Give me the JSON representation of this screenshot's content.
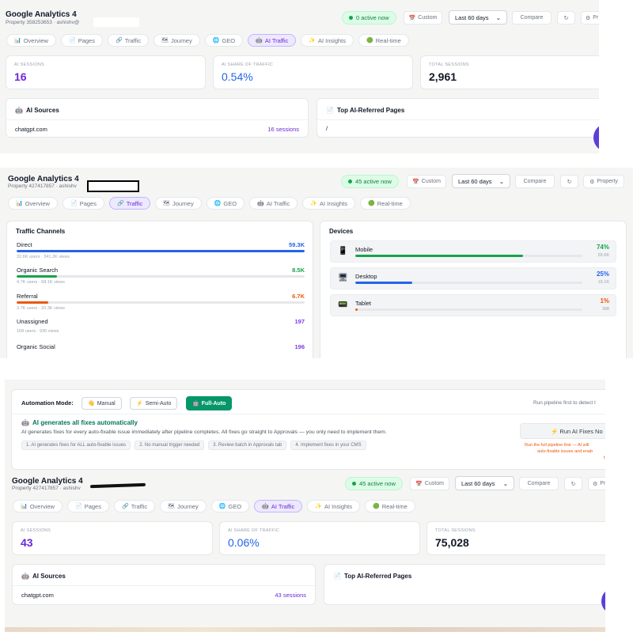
{
  "tabs": [
    {
      "icon": "📊",
      "label": "Overview"
    },
    {
      "icon": "📄",
      "label": "Pages"
    },
    {
      "icon": "🔗",
      "label": "Traffic"
    },
    {
      "icon": "🗺",
      "label": "Journey"
    },
    {
      "icon": "🌐",
      "label": "GEO"
    },
    {
      "icon": "🤖",
      "label": "AI Traffic"
    },
    {
      "icon": "✨",
      "label": "AI Insights"
    },
    {
      "icon": "🟢",
      "label": "Real-time"
    }
  ],
  "toolbar": {
    "custom": "Custom",
    "range": "Last 60 days",
    "compare": "Compare",
    "refresh": "↻",
    "property": "Property",
    "property_short": "Pr"
  },
  "panel1": {
    "title": "Google Analytics 4",
    "property": "Property 358253653 · ashishv@",
    "active": "0 active now",
    "kpis": [
      {
        "label": "AI SESSIONS",
        "value": "16"
      },
      {
        "label": "AI SHARE OF TRAFFIC",
        "value": "0.54%"
      },
      {
        "label": "TOTAL SESSIONS",
        "value": "2,961"
      }
    ],
    "ai_sources_title": "AI Sources",
    "sources": [
      {
        "name": "chatgpt.com",
        "sessions": "16 sessions"
      }
    ],
    "top_pages_title": "Top AI-Referred Pages",
    "pages": [
      "/"
    ]
  },
  "panel2": {
    "title": "Google Analytics 4",
    "property": "Property 427417857 · ashishv",
    "active": "45 active now",
    "channels_title": "Traffic Channels",
    "channels": [
      {
        "name": "Direct",
        "value": "59.3K",
        "sub": "32.6K users · 341.2K views",
        "share": 100,
        "color": "#2563eb"
      },
      {
        "name": "Organic Search",
        "value": "8.5K",
        "sub": "4.7K users · 68.1K views",
        "share": 14,
        "color": "#16a34a"
      },
      {
        "name": "Referral",
        "value": "6.7K",
        "sub": "3.7K users · 20.3K views",
        "share": 11,
        "color": "#ea580c"
      },
      {
        "name": "Unassigned",
        "value": "197",
        "sub": "168 users · 935 views",
        "share": 0,
        "color": "#7c3aed"
      },
      {
        "name": "Organic Social",
        "value": "196",
        "sub": "",
        "share": 0,
        "color": "#7c3aed"
      }
    ],
    "devices_title": "Devices",
    "devices": [
      {
        "icon": "📱",
        "name": "Mobile",
        "pct": "74%",
        "count": "55.6K",
        "share": 74,
        "color": "#16a34a"
      },
      {
        "icon": "🖥",
        "name": "Desktop",
        "pct": "25%",
        "count": "19.1K",
        "share": 25,
        "color": "#2563eb"
      },
      {
        "icon": "📟",
        "name": "Tablet",
        "pct": "1%",
        "count": "398",
        "share": 1,
        "color": "#ea580c"
      }
    ]
  },
  "panel3": {
    "automation_label": "Automation Mode:",
    "modes": [
      {
        "icon": "👋",
        "label": "Manual"
      },
      {
        "icon": "⚡",
        "label": "Semi-Auto"
      },
      {
        "icon": "🤖",
        "label": "Full-Auto"
      }
    ],
    "pipeline_hint": "Run pipeline first to detect I",
    "auto_title": "AI generates all fixes automatically",
    "auto_desc": "AI generates fixes for every auto-fixable issue immediately after pipeline completes. All fixes go straight to Approvals — you only need to implement them.",
    "steps": [
      "1. AI generates fixes for ALL auto-fixable issues",
      "2. No manual trigger needed",
      "3. Review batch in Approvals tab",
      "4. Implement fixes in your CMS"
    ],
    "run_button": "⚡ Run AI Fixes No",
    "run_note_1": "Run the full pipeline first — AI will",
    "run_note_2": "auto-fixable issues and enab",
    "run_note_3": "t",
    "title": "Google Analytics 4",
    "property": "Property 427417857 · ashishv",
    "active": "45 active now",
    "kpis": [
      {
        "label": "AI SESSIONS",
        "value": "43"
      },
      {
        "label": "AI SHARE OF TRAFFIC",
        "value": "0.06%"
      },
      {
        "label": "TOTAL SESSIONS",
        "value": "75,028"
      }
    ],
    "ai_sources_title": "AI Sources",
    "sources": [
      {
        "name": "chatgpt.com",
        "sessions": "43 sessions"
      }
    ],
    "top_pages_title": "Top AI-Referred Pages"
  }
}
